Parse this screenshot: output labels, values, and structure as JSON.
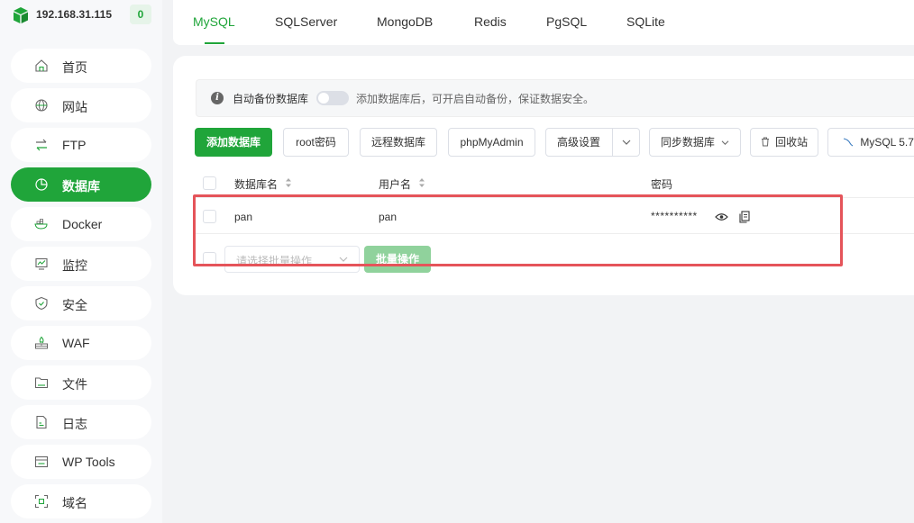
{
  "server": {
    "ip": "192.168.31.115",
    "badge_count": "0"
  },
  "sidebar": {
    "items": [
      {
        "label": "首页",
        "icon": "home-icon"
      },
      {
        "label": "网站",
        "icon": "globe-icon"
      },
      {
        "label": "FTP",
        "icon": "transfer-icon"
      },
      {
        "label": "数据库",
        "icon": "database-icon",
        "active": true
      },
      {
        "label": "Docker",
        "icon": "docker-icon"
      },
      {
        "label": "监控",
        "icon": "monitor-icon"
      },
      {
        "label": "安全",
        "icon": "shield-icon"
      },
      {
        "label": "WAF",
        "icon": "firewall-icon"
      },
      {
        "label": "文件",
        "icon": "folder-icon"
      },
      {
        "label": "日志",
        "icon": "log-icon"
      },
      {
        "label": "WP Tools",
        "icon": "wordpress-icon"
      },
      {
        "label": "域名",
        "icon": "domain-icon"
      }
    ]
  },
  "tabs": [
    {
      "label": "MySQL",
      "active": true
    },
    {
      "label": "SQLServer"
    },
    {
      "label": "MongoDB"
    },
    {
      "label": "Redis"
    },
    {
      "label": "PgSQL"
    },
    {
      "label": "SQLite"
    }
  ],
  "notice": {
    "toggle_label": "自动备份数据库",
    "toggle_on": false,
    "description": "添加数据库后，可开启自动备份，保证数据安全。"
  },
  "toolbar": {
    "add_db": "添加数据库",
    "root_pw": "root密码",
    "remote_db": "远程数据库",
    "phpmyadmin": "phpMyAdmin",
    "advanced": "高级设置",
    "sync_db": "同步数据库",
    "recycle": "回收站",
    "mysql_version": "MySQL 5.7"
  },
  "table": {
    "headers": {
      "db_name": "数据库名",
      "username": "用户名",
      "password": "密码"
    },
    "rows": [
      {
        "db_name": "pan",
        "username": "pan",
        "password": "**********"
      }
    ]
  },
  "batch": {
    "placeholder": "请选择批量操作",
    "button": "批量操作"
  },
  "colors": {
    "accent": "#20a53a",
    "highlight": "#e5545a"
  }
}
